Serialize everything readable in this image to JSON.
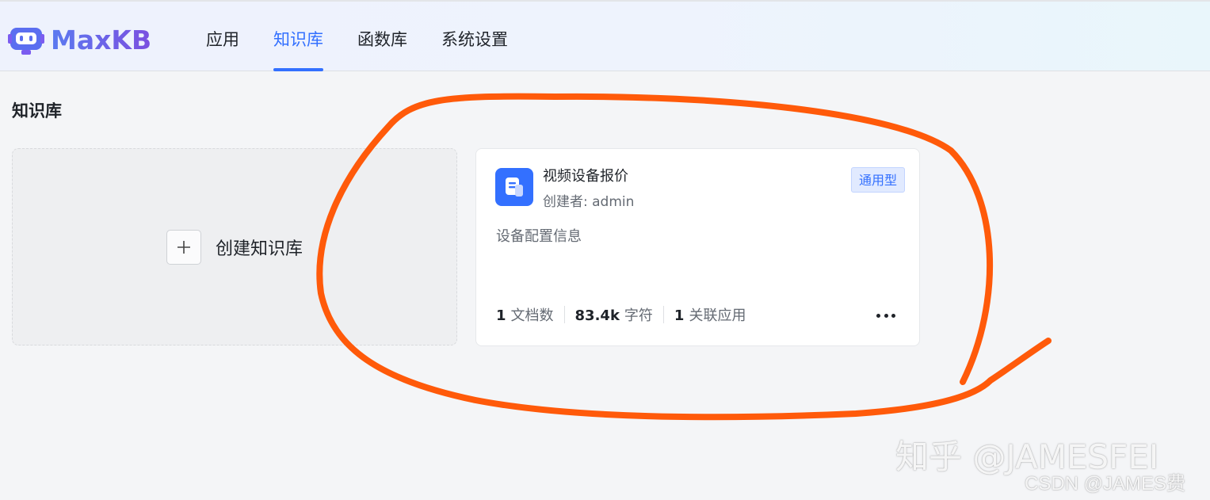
{
  "app": {
    "brand": "MaxKB",
    "brand_icon": "robot-icon",
    "brand_color": "#5b6ef0"
  },
  "nav": {
    "items": [
      {
        "label": "应用",
        "active": false
      },
      {
        "label": "知识库",
        "active": true
      },
      {
        "label": "函数库",
        "active": false
      },
      {
        "label": "系统设置",
        "active": false
      }
    ],
    "accent_color": "#3370ff"
  },
  "page": {
    "title": "知识库"
  },
  "create_card": {
    "icon": "plus-icon",
    "label": "创建知识库"
  },
  "knowledge_base": {
    "icon": "document-icon",
    "name": "视频设备报价",
    "creator": "创建者: admin",
    "tag": "通用型",
    "description": "设备配置信息",
    "stats": {
      "documents_value": "1",
      "documents_label": "文档数",
      "chars_value": "83.4k",
      "chars_label": "字符",
      "apps_value": "1",
      "apps_label": "关联应用"
    },
    "more_icon": "more-horizontal-icon"
  },
  "annotation": {
    "color": "#ff5a0a"
  },
  "watermarks": {
    "zhihu": "知乎 @JAMESFEI",
    "csdn": "CSDN @JAMES费"
  }
}
